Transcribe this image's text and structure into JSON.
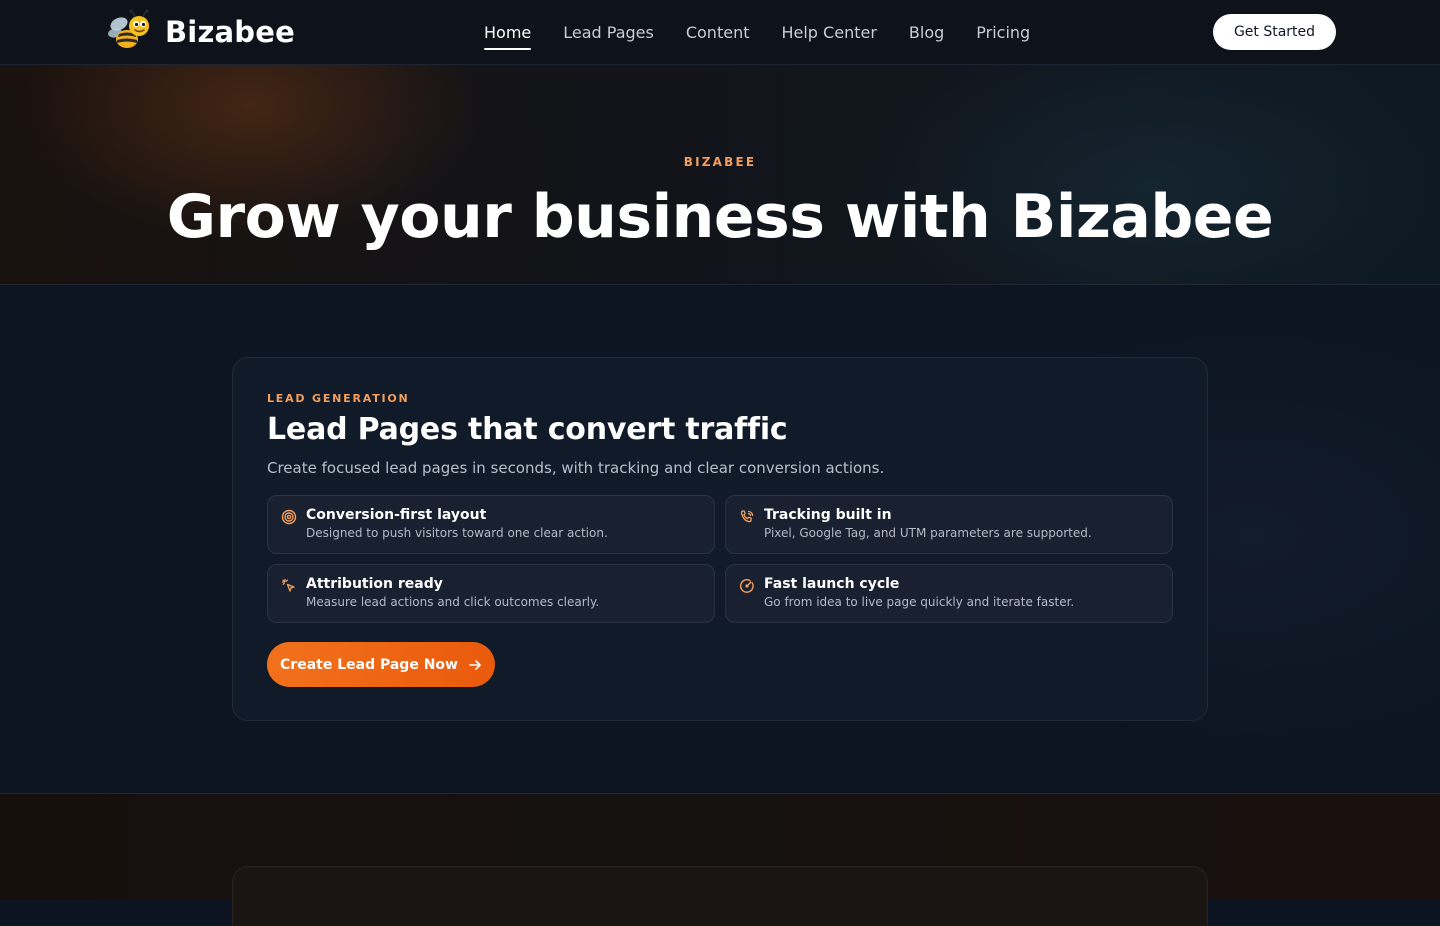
{
  "nav": {
    "brand": "Bizabee",
    "links": [
      {
        "label": "Home",
        "active": true
      },
      {
        "label": "Lead Pages"
      },
      {
        "label": "Content"
      },
      {
        "label": "Help Center"
      },
      {
        "label": "Blog"
      },
      {
        "label": "Pricing"
      }
    ],
    "cta": "Get Started"
  },
  "hero": {
    "eyebrow": "BIZABEE",
    "title": "Grow your business with Bizabee"
  },
  "lead_section": {
    "eyebrow": "LEAD GENERATION",
    "title": "Lead Pages that convert traffic",
    "subtitle": "Create focused lead pages in seconds, with tracking and clear conversion actions.",
    "features": [
      {
        "icon": "target-icon",
        "title": "Conversion-first layout",
        "desc": "Designed to push visitors toward one clear action."
      },
      {
        "icon": "phone-tracking-icon",
        "title": "Tracking built in",
        "desc": "Pixel, Google Tag, and UTM parameters are supported."
      },
      {
        "icon": "sparkle-pointer-icon",
        "title": "Attribution ready",
        "desc": "Measure lead actions and click outcomes clearly."
      },
      {
        "icon": "gauge-icon",
        "title": "Fast launch cycle",
        "desc": "Go from idea to live page quickly and iterate faster."
      }
    ],
    "cta": "Create Lead Page Now"
  },
  "colors": {
    "accent": "#f59e5b",
    "cta_orange": "#f2711c",
    "background": "#0d1522"
  }
}
